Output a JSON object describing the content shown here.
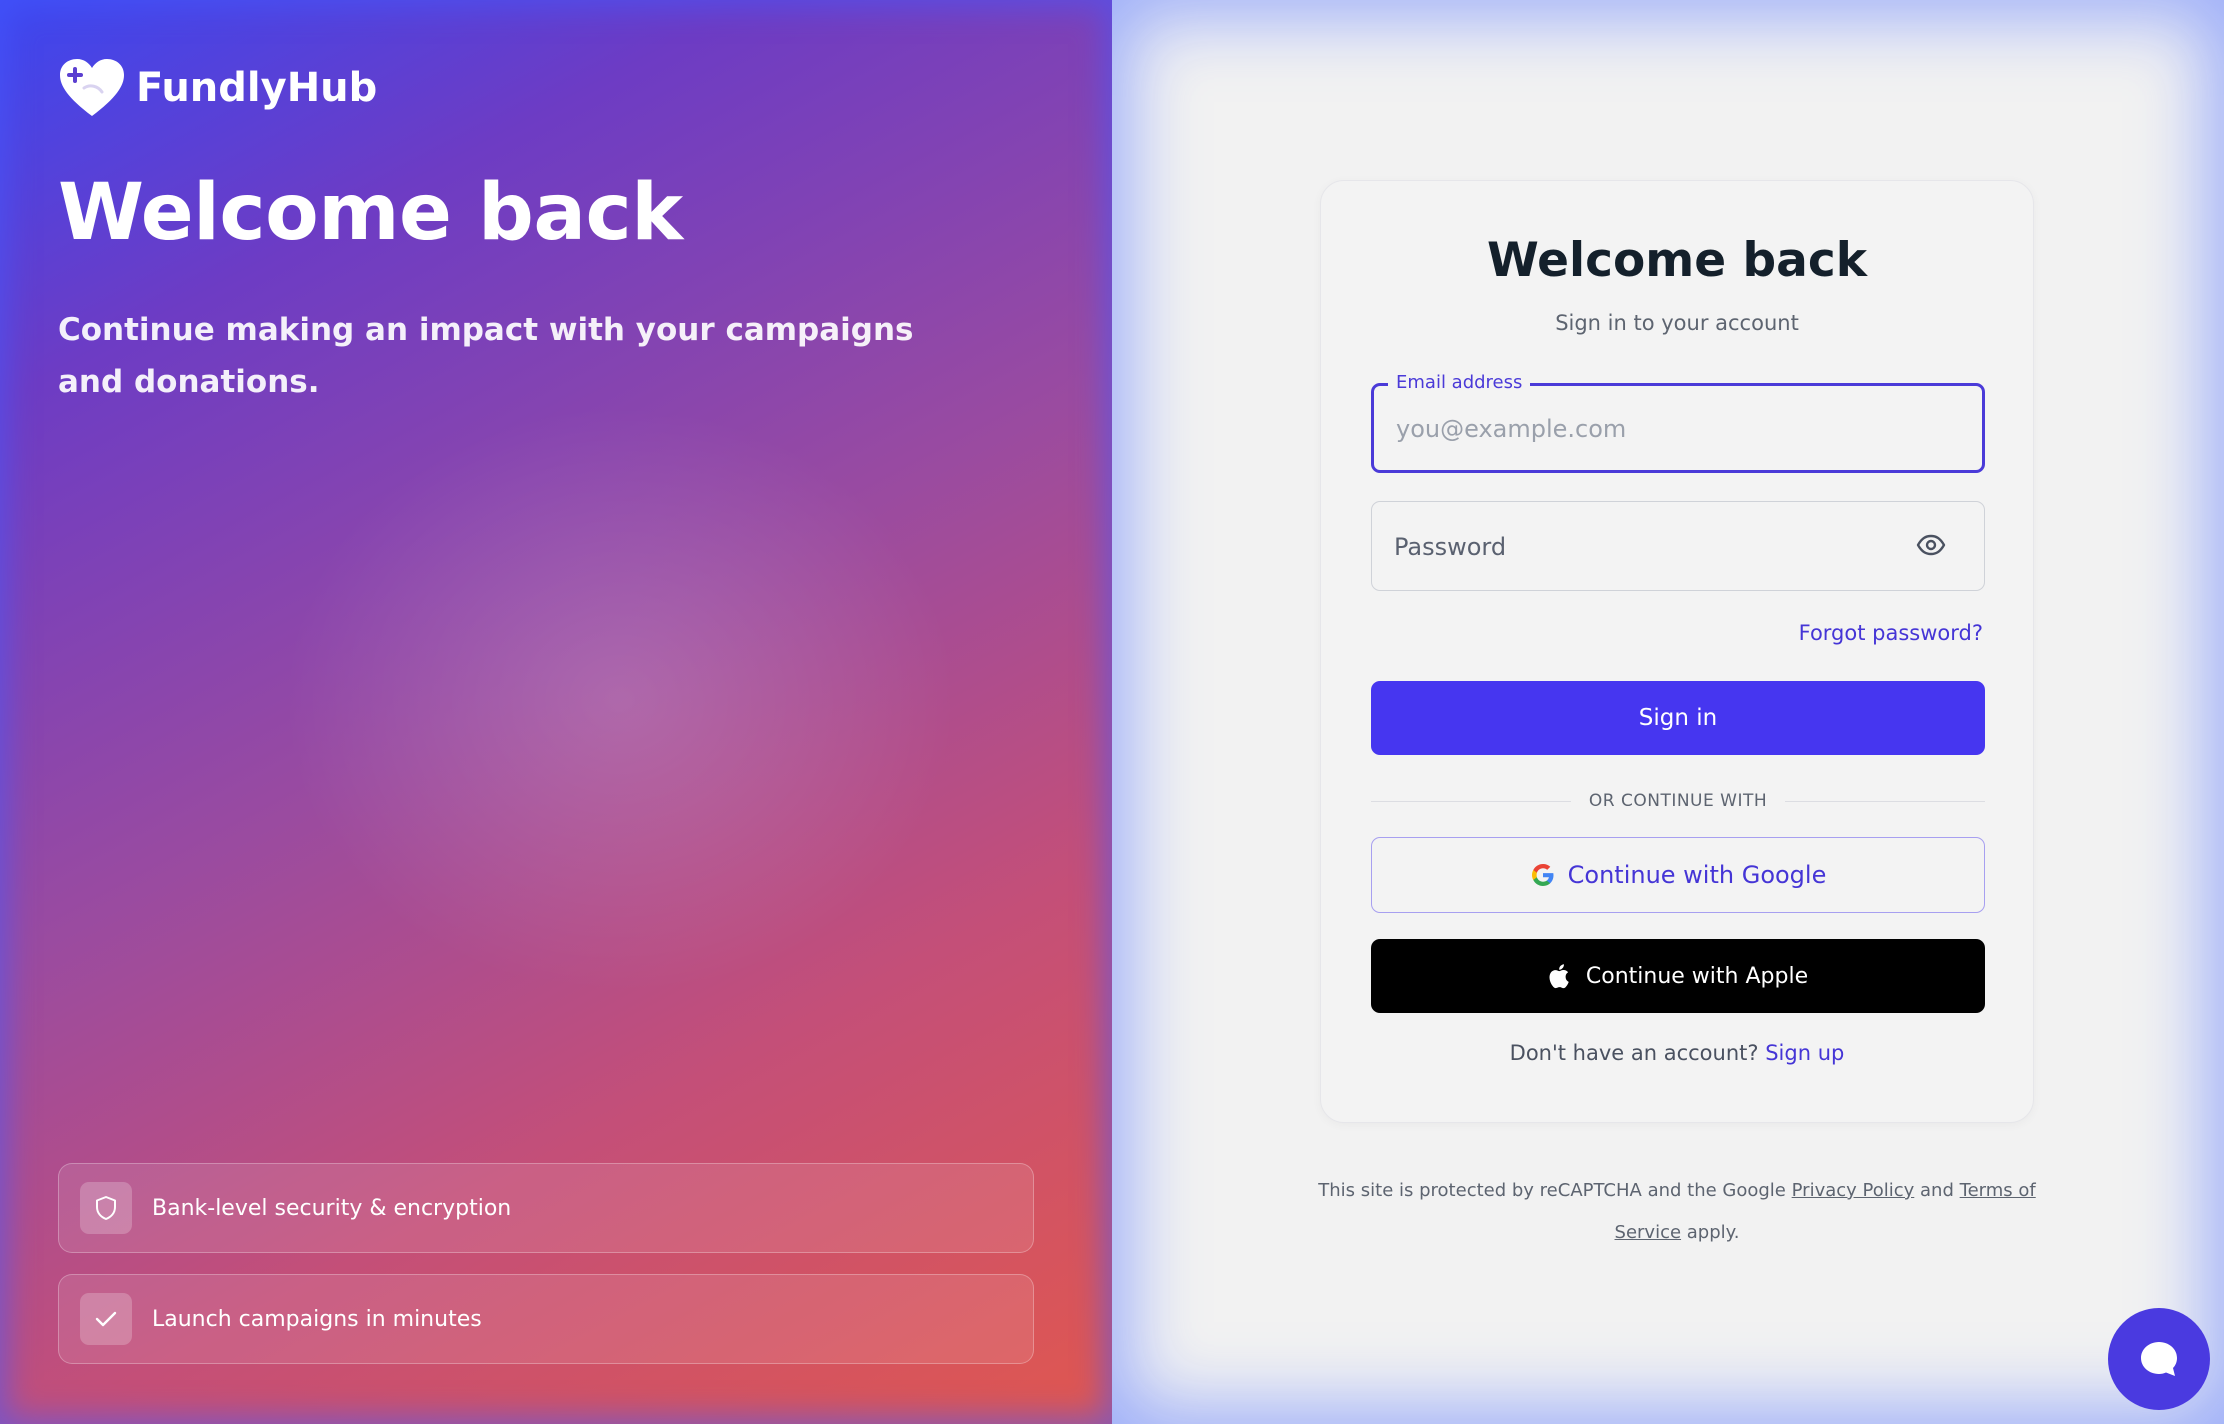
{
  "brand": {
    "name": "FundlyHub",
    "logo_icon": "heart-plus-icon"
  },
  "hero": {
    "title": "Welcome back",
    "subtitle": "Continue making an impact with your campaigns and donations."
  },
  "features": [
    {
      "icon": "shield-icon",
      "label": "Bank-level security & encryption"
    },
    {
      "icon": "check-icon",
      "label": "Launch campaigns in minutes"
    }
  ],
  "login": {
    "title": "Welcome back",
    "subtitle": "Sign in to your account",
    "email": {
      "label": "Email address",
      "placeholder": "you@example.com",
      "value": ""
    },
    "password": {
      "placeholder": "Password",
      "value": "",
      "toggle_icon": "eye-icon"
    },
    "forgot_label": "Forgot password?",
    "signin_label": "Sign in",
    "divider_text": "OR CONTINUE WITH",
    "google_label": "Continue with Google",
    "apple_label": "Continue with Apple",
    "signup_prompt": "Don't have an account?",
    "signup_link": "Sign up"
  },
  "legal": {
    "prefix": "This site is protected by reCAPTCHA and the Google",
    "privacy": "Privacy Policy",
    "and": "and",
    "terms": "Terms of Service",
    "suffix": "apply."
  },
  "chat": {
    "icon": "chat-bubble-icon"
  },
  "colors": {
    "accent": "#4636f0",
    "link": "#4535d6",
    "apple_button": "#000000",
    "gradient_start": "#3c47f0",
    "gradient_end": "#e0574f"
  }
}
